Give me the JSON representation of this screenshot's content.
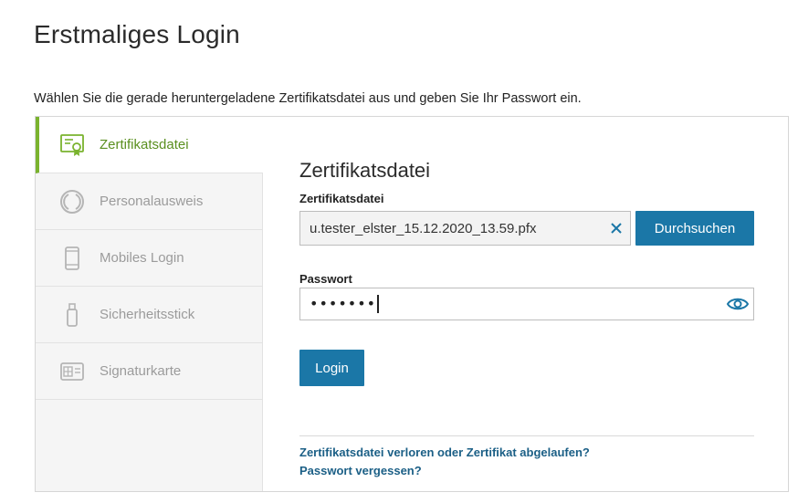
{
  "page": {
    "title": "Erstmaliges Login",
    "intro": "Wählen Sie die gerade heruntergeladene Zertifikatsdatei aus und geben Sie Ihr Passwort ein."
  },
  "sidebar": {
    "items": [
      {
        "label": "Zertifikatsdatei",
        "icon": "certificate-icon",
        "active": true
      },
      {
        "label": "Personalausweis",
        "icon": "id-card-icon",
        "active": false
      },
      {
        "label": "Mobiles Login",
        "icon": "smartphone-icon",
        "active": false
      },
      {
        "label": "Sicherheitsstick",
        "icon": "usb-stick-icon",
        "active": false
      },
      {
        "label": "Signaturkarte",
        "icon": "signature-card-icon",
        "active": false
      }
    ]
  },
  "form": {
    "section_title": "Zertifikatsdatei",
    "file_label": "Zertifikatsdatei",
    "file_value": "u.tester_elster_15.12.2020_13.59.pfx",
    "browse_label": "Durchsuchen",
    "password_label": "Passwort",
    "password_value": "•••••••",
    "login_label": "Login"
  },
  "links": {
    "lost_certificate": "Zertifikatsdatei verloren oder Zertifikat abgelaufen?",
    "forgot_password": "Passwort vergessen?"
  },
  "colors": {
    "accent_green": "#7ab32e",
    "primary_blue": "#1b77a7",
    "link_blue": "#1b5f86"
  }
}
